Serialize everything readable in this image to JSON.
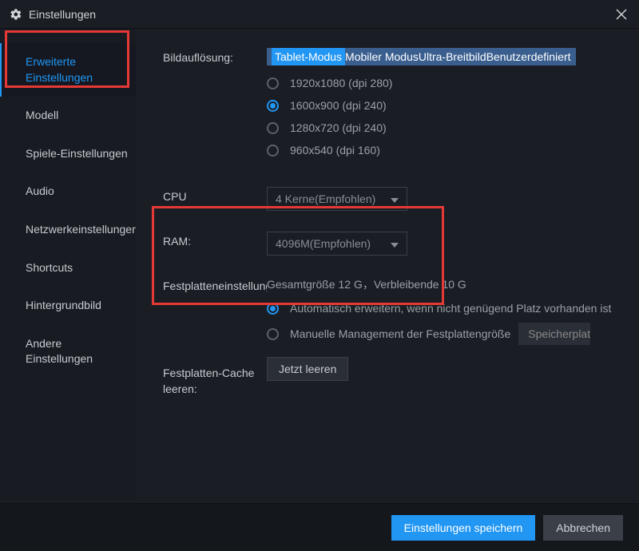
{
  "title": "Einstellungen",
  "sidebar": {
    "items": [
      {
        "label": "Erweiterte\nEinstellungen",
        "id": "sidebar-erweiterte"
      },
      {
        "label": "Modell",
        "id": "sidebar-modell"
      },
      {
        "label": "Spiele-Einstellungen",
        "id": "sidebar-spiele"
      },
      {
        "label": "Audio",
        "id": "sidebar-audio"
      },
      {
        "label": "Netzwerkeinstellungen",
        "id": "sidebar-netzwerk"
      },
      {
        "label": "Shortcuts",
        "id": "sidebar-shortcuts"
      },
      {
        "label": "Hintergrundbild",
        "id": "sidebar-hintergrund"
      },
      {
        "label": "Andere\nEinstellungen",
        "id": "sidebar-andere"
      }
    ],
    "active_index": 0
  },
  "resolution": {
    "label": "Bildauflösung:",
    "modes": [
      "Tablet-Modus",
      "Mobiler Modus",
      "Ultra-Breitbild",
      "Benutzerdefiniert"
    ],
    "options": [
      {
        "label": "1920x1080  (dpi 280)",
        "checked": false
      },
      {
        "label": "1600x900  (dpi 240)",
        "checked": true
      },
      {
        "label": "1280x720  (dpi 240)",
        "checked": false
      },
      {
        "label": "960x540  (dpi 160)",
        "checked": false
      }
    ]
  },
  "cpu": {
    "label": "CPU",
    "value": "4 Kerne(Empfohlen)"
  },
  "ram": {
    "label": "RAM:",
    "value": "4096M(Empfohlen)"
  },
  "disk": {
    "label": "Festplatteneinstellungen",
    "info": "Gesamtgröße 12 G，Verbleibende 10 G",
    "auto": {
      "label": "Automatisch erweitern, wenn nicht genügend Platz vorhanden ist",
      "checked": true
    },
    "manual": {
      "label": "Manuelle Management der Festplattengröße",
      "checked": false,
      "button": "Speicherplatz erweitern"
    }
  },
  "cache": {
    "label": "Festplatten-Cache leeren:",
    "button": "Jetzt leeren"
  },
  "footer": {
    "save": "Einstellungen speichern",
    "cancel": "Abbrechen"
  }
}
